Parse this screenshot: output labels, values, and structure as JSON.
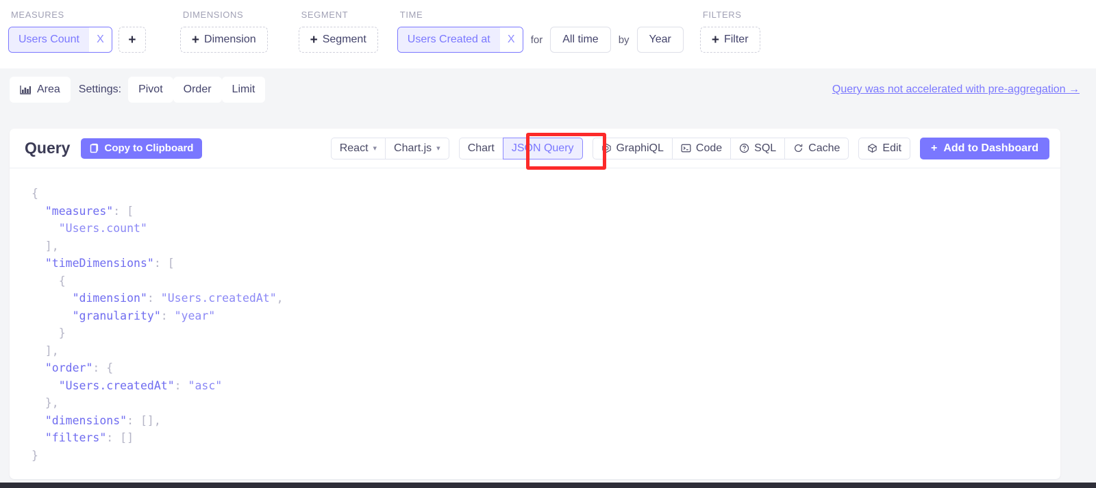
{
  "builder": {
    "groups": {
      "measures": {
        "label": "MEASURES",
        "pill": {
          "text": "Users Count",
          "remove": "X"
        },
        "add": "+"
      },
      "dimensions": {
        "label": "DIMENSIONS",
        "add": "Dimension",
        "plus": "+"
      },
      "segment": {
        "label": "SEGMENT",
        "add": "Segment",
        "plus": "+"
      },
      "time": {
        "label": "TIME",
        "pill": {
          "text": "Users Created at",
          "remove": "X"
        },
        "for_word": "for",
        "range": "All time",
        "by_word": "by",
        "granularity": "Year"
      },
      "filters": {
        "label": "FILTERS",
        "add": "Filter",
        "plus": "+"
      }
    }
  },
  "settings": {
    "chart_type": "Area",
    "chart_type_icon": "bar-chart-icon",
    "settings_label": "Settings:",
    "pivot": "Pivot",
    "order": "Order",
    "limit": "Limit",
    "acceleration_notice": "Query was not accelerated with pre-aggregation →"
  },
  "query_card": {
    "title": "Query",
    "copy_button": "Copy to Clipboard",
    "copy_icon": "clipboard-icon",
    "framework_select": "React",
    "charting_select": "Chart.js",
    "tabs": [
      {
        "label": "Chart",
        "active": false
      },
      {
        "label": "JSON Query",
        "active": true
      }
    ],
    "tools": [
      {
        "label": "GraphiQL",
        "icon": "graphiql-icon"
      },
      {
        "label": "Code",
        "icon": "terminal-icon"
      },
      {
        "label": "SQL",
        "icon": "question-circle-icon"
      },
      {
        "label": "Cache",
        "icon": "refresh-icon"
      }
    ],
    "edit": {
      "label": "Edit",
      "icon": "cube-icon"
    },
    "add_to_dashboard": {
      "label": "Add to Dashboard",
      "plus": "+"
    }
  },
  "json_query": {
    "lines": [
      [
        {
          "t": "{",
          "c": "p"
        }
      ],
      [
        {
          "t": "  ",
          "c": "p"
        },
        {
          "t": "\"measures\"",
          "c": "k"
        },
        {
          "t": ": [",
          "c": "p"
        }
      ],
      [
        {
          "t": "    ",
          "c": "p"
        },
        {
          "t": "\"Users.count\"",
          "c": "s"
        }
      ],
      [
        {
          "t": "  ],",
          "c": "p"
        }
      ],
      [
        {
          "t": "  ",
          "c": "p"
        },
        {
          "t": "\"timeDimensions\"",
          "c": "k"
        },
        {
          "t": ": [",
          "c": "p"
        }
      ],
      [
        {
          "t": "    {",
          "c": "p"
        }
      ],
      [
        {
          "t": "      ",
          "c": "p"
        },
        {
          "t": "\"dimension\"",
          "c": "k"
        },
        {
          "t": ": ",
          "c": "p"
        },
        {
          "t": "\"Users.createdAt\"",
          "c": "s"
        },
        {
          "t": ",",
          "c": "p"
        }
      ],
      [
        {
          "t": "      ",
          "c": "p"
        },
        {
          "t": "\"granularity\"",
          "c": "k"
        },
        {
          "t": ": ",
          "c": "p"
        },
        {
          "t": "\"year\"",
          "c": "s"
        }
      ],
      [
        {
          "t": "    }",
          "c": "p"
        }
      ],
      [
        {
          "t": "  ],",
          "c": "p"
        }
      ],
      [
        {
          "t": "  ",
          "c": "p"
        },
        {
          "t": "\"order\"",
          "c": "k"
        },
        {
          "t": ": {",
          "c": "p"
        }
      ],
      [
        {
          "t": "    ",
          "c": "p"
        },
        {
          "t": "\"Users.createdAt\"",
          "c": "k"
        },
        {
          "t": ": ",
          "c": "p"
        },
        {
          "t": "\"asc\"",
          "c": "s"
        }
      ],
      [
        {
          "t": "  },",
          "c": "p"
        }
      ],
      [
        {
          "t": "  ",
          "c": "p"
        },
        {
          "t": "\"dimensions\"",
          "c": "k"
        },
        {
          "t": ": [],",
          "c": "p"
        }
      ],
      [
        {
          "t": "  ",
          "c": "p"
        },
        {
          "t": "\"filters\"",
          "c": "k"
        },
        {
          "t": ": []",
          "c": "p"
        }
      ],
      [
        {
          "t": "}",
          "c": "p"
        }
      ]
    ]
  },
  "annotation": {
    "type": "red-highlight-box",
    "target": "JSON Query"
  },
  "colors": {
    "accent": "#7a77ff",
    "accent_bg": "#eeeeff",
    "page_bg": "#f4f5f7",
    "annotation_red": "#fc2a2a",
    "text": "#43436b",
    "muted": "#a1a1b5"
  }
}
